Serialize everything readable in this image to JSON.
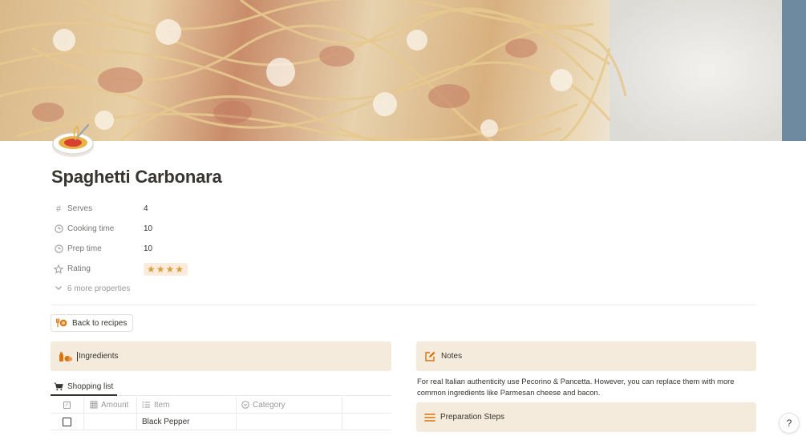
{
  "page": {
    "title": "Spaghetti Carbonara",
    "cover_description": "spaghetti-cover-photo",
    "icon": "spaghetti-icon"
  },
  "properties": [
    {
      "icon": "hash-icon",
      "label": "Serves",
      "value": "4"
    },
    {
      "icon": "clock-icon",
      "label": "Cooking time",
      "value": "10"
    },
    {
      "icon": "clock-icon",
      "label": "Prep time",
      "value": "10"
    },
    {
      "icon": "star-icon",
      "label": "Rating",
      "value": "★★★★"
    }
  ],
  "more_properties": "6 more properties",
  "back_button": {
    "label": "Back to recipes",
    "icon": "fork-plate-icon"
  },
  "ingredients": {
    "label": "Ingredients",
    "icon": "ingredients-icon"
  },
  "notes": {
    "label": "Notes",
    "icon": "edit-icon",
    "text": "For real Italian authenticity use Pecorino & Pancetta. However, you can replace them with more common ingredients like Parmesan cheese and bacon."
  },
  "preparation": {
    "label": "Preparation Steps",
    "icon": "list-icon"
  },
  "shopping": {
    "tab_label": "Shopping list",
    "columns": [
      "Amount",
      "Item",
      "Category"
    ],
    "rows": [
      {
        "checked": false,
        "amount": "",
        "item": "Black Pepper",
        "category": ""
      }
    ]
  },
  "help": {
    "label": "?"
  },
  "colors": {
    "callout_bg": "#f4ebdd",
    "accent_orange": "#d9730d",
    "star": "#d9a13b",
    "text": "#37352f",
    "muted": "#787774"
  }
}
